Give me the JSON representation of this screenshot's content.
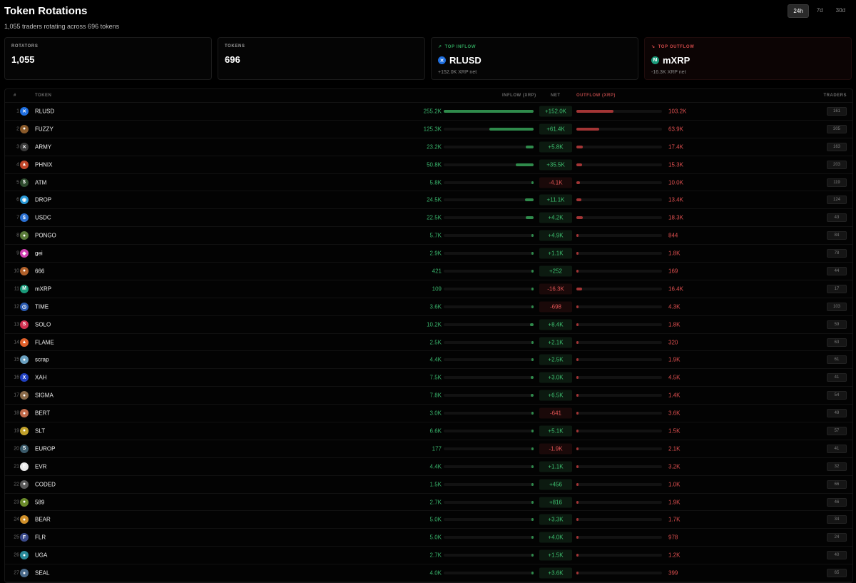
{
  "header": {
    "title": "Token Rotations",
    "subtitle": "1,055 traders rotating across 696 tokens"
  },
  "range_tabs": [
    {
      "label": "24h",
      "active": true
    },
    {
      "label": "7d",
      "active": false
    },
    {
      "label": "30d",
      "active": false
    }
  ],
  "cards": {
    "rotators": {
      "label": "ROTATORS",
      "value": "1,055"
    },
    "tokens": {
      "label": "TOKENS",
      "value": "696"
    },
    "top_inflow": {
      "label": "TOP INFLOW",
      "token": "RLUSD",
      "sub": "+152.0K XRP net"
    },
    "top_outflow": {
      "label": "TOP OUTFLOW",
      "token": "mXRP",
      "sub": "-16.3K XRP net"
    }
  },
  "columns": {
    "num": "#",
    "token": "TOKEN",
    "inflow": "INFLOW (XRP)",
    "net": "NET",
    "outflow": "OUTFLOW (XRP)",
    "traders": "TRADERS"
  },
  "rows": [
    {
      "n": "1",
      "name": "RLUSD",
      "inflow": "255.2K",
      "in_v": 255.2,
      "net": "+152.0K",
      "pos": true,
      "outflow": "103.2K",
      "out_v": 103.2,
      "traders": "161",
      "color": "#1f6fe0",
      "glyph": "✕"
    },
    {
      "n": "2",
      "name": "FUZZY",
      "inflow": "125.3K",
      "in_v": 125.3,
      "net": "+61.4K",
      "pos": true,
      "outflow": "63.9K",
      "out_v": 63.9,
      "traders": "305",
      "color": "#8a5a2a",
      "glyph": "●"
    },
    {
      "n": "3",
      "name": "ARMY",
      "inflow": "23.2K",
      "in_v": 23.2,
      "net": "+5.8K",
      "pos": true,
      "outflow": "17.4K",
      "out_v": 17.4,
      "traders": "163",
      "color": "#3a3a3a",
      "glyph": "✕"
    },
    {
      "n": "4",
      "name": "PHNIX",
      "inflow": "50.8K",
      "in_v": 50.8,
      "net": "+35.5K",
      "pos": true,
      "outflow": "15.3K",
      "out_v": 15.3,
      "traders": "203",
      "color": "#c0462a",
      "glyph": "▲"
    },
    {
      "n": "5",
      "name": "ATM",
      "inflow": "5.8K",
      "in_v": 5.8,
      "net": "-4.1K",
      "pos": false,
      "outflow": "10.0K",
      "out_v": 10.0,
      "traders": "119",
      "color": "#2d4a2d",
      "glyph": "$"
    },
    {
      "n": "6",
      "name": "DROP",
      "inflow": "24.5K",
      "in_v": 24.5,
      "net": "+11.1K",
      "pos": true,
      "outflow": "13.4K",
      "out_v": 13.4,
      "traders": "124",
      "color": "#2a9ad8",
      "glyph": "◉"
    },
    {
      "n": "7",
      "name": "USDC",
      "inflow": "22.5K",
      "in_v": 22.5,
      "net": "+4.2K",
      "pos": true,
      "outflow": "18.3K",
      "out_v": 18.3,
      "traders": "43",
      "color": "#2a6fd0",
      "glyph": "$"
    },
    {
      "n": "8",
      "name": "PONGO",
      "inflow": "5.7K",
      "in_v": 5.7,
      "net": "+4.9K",
      "pos": true,
      "outflow": "844",
      "out_v": 0.844,
      "traders": "84",
      "color": "#5a7a3a",
      "glyph": "●"
    },
    {
      "n": "9",
      "name": "gei",
      "inflow": "2.9K",
      "in_v": 2.9,
      "net": "+1.1K",
      "pos": true,
      "outflow": "1.8K",
      "out_v": 1.8,
      "traders": "78",
      "color": "#d040b0",
      "glyph": "◆"
    },
    {
      "n": "10",
      "name": "666",
      "inflow": "421",
      "in_v": 0.421,
      "net": "+252",
      "pos": true,
      "outflow": "169",
      "out_v": 0.169,
      "traders": "44",
      "color": "#b0602a",
      "glyph": "●"
    },
    {
      "n": "11",
      "name": "mXRP",
      "inflow": "109",
      "in_v": 0.109,
      "net": "-16.3K",
      "pos": false,
      "outflow": "16.4K",
      "out_v": 16.4,
      "traders": "17",
      "color": "#1a9a7a",
      "glyph": "M"
    },
    {
      "n": "12",
      "name": "TIME",
      "inflow": "3.6K",
      "in_v": 3.6,
      "net": "-698",
      "pos": false,
      "outflow": "4.3K",
      "out_v": 4.3,
      "traders": "103",
      "color": "#2a5ab0",
      "glyph": "◷"
    },
    {
      "n": "13",
      "name": "SOLO",
      "inflow": "10.2K",
      "in_v": 10.2,
      "net": "+8.4K",
      "pos": true,
      "outflow": "1.8K",
      "out_v": 1.8,
      "traders": "59",
      "color": "#d03050",
      "glyph": "S"
    },
    {
      "n": "14",
      "name": "FLAME",
      "inflow": "2.5K",
      "in_v": 2.5,
      "net": "+2.1K",
      "pos": true,
      "outflow": "320",
      "out_v": 0.32,
      "traders": "63",
      "color": "#e0602a",
      "glyph": "▲"
    },
    {
      "n": "15",
      "name": "scrap",
      "inflow": "4.4K",
      "in_v": 4.4,
      "net": "+2.5K",
      "pos": true,
      "outflow": "1.9K",
      "out_v": 1.9,
      "traders": "61",
      "color": "#6aa0c0",
      "glyph": "●"
    },
    {
      "n": "16",
      "name": "XAH",
      "inflow": "7.5K",
      "in_v": 7.5,
      "net": "+3.0K",
      "pos": true,
      "outflow": "4.5K",
      "out_v": 4.5,
      "traders": "41",
      "color": "#2040c0",
      "glyph": "X"
    },
    {
      "n": "17",
      "name": "SIGMA",
      "inflow": "7.8K",
      "in_v": 7.8,
      "net": "+6.5K",
      "pos": true,
      "outflow": "1.4K",
      "out_v": 1.4,
      "traders": "54",
      "color": "#8a6a4a",
      "glyph": "●"
    },
    {
      "n": "18",
      "name": "BERT",
      "inflow": "3.0K",
      "in_v": 3.0,
      "net": "-641",
      "pos": false,
      "outflow": "3.6K",
      "out_v": 3.6,
      "traders": "49",
      "color": "#c06a4a",
      "glyph": "●"
    },
    {
      "n": "19",
      "name": "SLT",
      "inflow": "6.6K",
      "in_v": 6.6,
      "net": "+5.1K",
      "pos": true,
      "outflow": "1.5K",
      "out_v": 1.5,
      "traders": "57",
      "color": "#c0a02a",
      "glyph": "●"
    },
    {
      "n": "20",
      "name": "EUROP",
      "inflow": "177",
      "in_v": 0.177,
      "net": "-1.9K",
      "pos": false,
      "outflow": "2.1K",
      "out_v": 2.1,
      "traders": "41",
      "color": "#3a5a6a",
      "glyph": "S"
    },
    {
      "n": "21",
      "name": "EVR",
      "inflow": "4.4K",
      "in_v": 4.4,
      "net": "+1.1K",
      "pos": true,
      "outflow": "3.2K",
      "out_v": 3.2,
      "traders": "32",
      "color": "#e8e8e8",
      "glyph": "E"
    },
    {
      "n": "22",
      "name": "CODED",
      "inflow": "1.5K",
      "in_v": 1.5,
      "net": "+456",
      "pos": true,
      "outflow": "1.0K",
      "out_v": 1.0,
      "traders": "66",
      "color": "#5a5a5a",
      "glyph": "●"
    },
    {
      "n": "23",
      "name": "589",
      "inflow": "2.7K",
      "in_v": 2.7,
      "net": "+816",
      "pos": true,
      "outflow": "1.9K",
      "out_v": 1.9,
      "traders": "46",
      "color": "#6a8a2a",
      "glyph": "●"
    },
    {
      "n": "24",
      "name": "BEAR",
      "inflow": "5.0K",
      "in_v": 5.0,
      "net": "+3.3K",
      "pos": true,
      "outflow": "1.7K",
      "out_v": 1.7,
      "traders": "34",
      "color": "#d0902a",
      "glyph": "●"
    },
    {
      "n": "25",
      "name": "FLR",
      "inflow": "5.0K",
      "in_v": 5.0,
      "net": "+4.0K",
      "pos": true,
      "outflow": "978",
      "out_v": 0.978,
      "traders": "24",
      "color": "#3a4a8a",
      "glyph": "F"
    },
    {
      "n": "26",
      "name": "UGA",
      "inflow": "2.7K",
      "in_v": 2.7,
      "net": "+1.5K",
      "pos": true,
      "outflow": "1.2K",
      "out_v": 1.2,
      "traders": "40",
      "color": "#2a8a9a",
      "glyph": "●"
    },
    {
      "n": "27",
      "name": "SEAL",
      "inflow": "4.0K",
      "in_v": 4.0,
      "net": "+3.6K",
      "pos": true,
      "outflow": "399",
      "out_v": 0.399,
      "traders": "65",
      "color": "#4a6a8a",
      "glyph": "●"
    }
  ],
  "colors": {
    "inflow": "#2f8a4b",
    "outflow": "#a33535",
    "positive": "#3ec070",
    "negative": "#e25555"
  }
}
